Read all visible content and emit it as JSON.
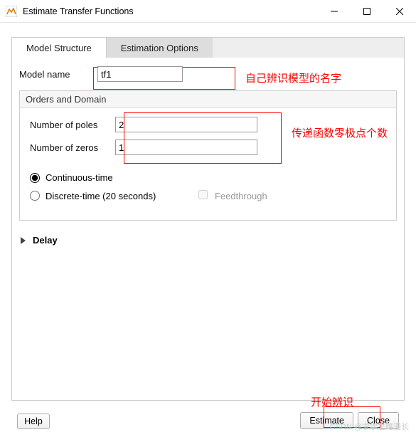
{
  "window": {
    "title": "Estimate Transfer Functions"
  },
  "tabs": {
    "model_structure": "Model Structure",
    "estimation_options": "Estimation Options"
  },
  "model_name": {
    "label": "Model name",
    "value": "tf1"
  },
  "orders_domain": {
    "group_title": "Orders and Domain",
    "poles_label": "Number of poles",
    "poles_value": "2",
    "zeros_label": "Number of zeros",
    "zeros_value": "1",
    "continuous_label": "Continuous-time",
    "discrete_label": "Discrete-time (20 seconds)",
    "feedthrough_label": "Feedthrough"
  },
  "delay": {
    "label": "Delay"
  },
  "footer": {
    "help": "Help",
    "estimate": "Estimate",
    "close": "Close"
  },
  "annotations": {
    "a1": "自己辨识模型的名字",
    "a2": "传递函数零极点个数",
    "a3": "开始辨识"
  },
  "watermark": "CSDN @求学之路漫长"
}
